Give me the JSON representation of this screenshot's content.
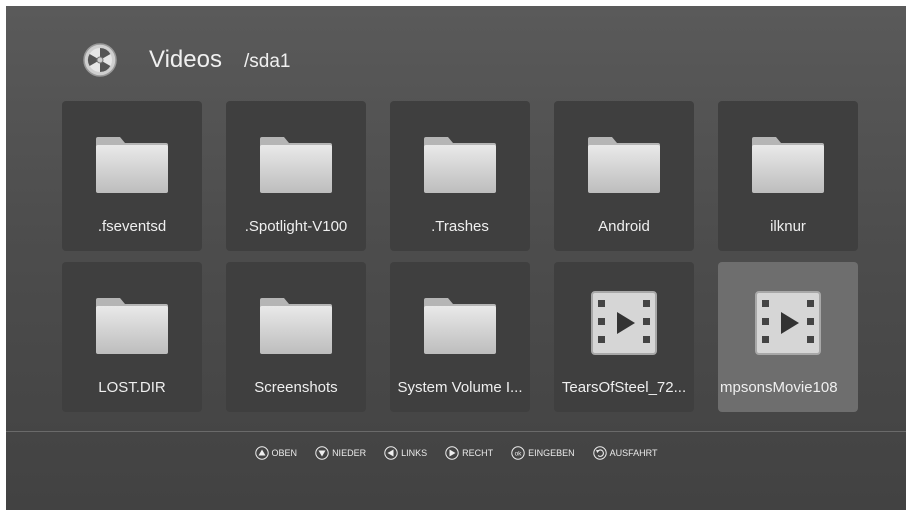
{
  "header": {
    "title": "Videos",
    "path": "/sda1"
  },
  "tiles": [
    {
      "label": ".fseventsd",
      "icon": "folder-icon"
    },
    {
      "label": ".Spotlight-V100",
      "icon": "folder-icon"
    },
    {
      "label": ".Trashes",
      "icon": "folder-icon"
    },
    {
      "label": "Android",
      "icon": "folder-icon"
    },
    {
      "label": "ilknur",
      "icon": "folder-icon"
    },
    {
      "label": "LOST.DIR",
      "icon": "folder-icon"
    },
    {
      "label": "Screenshots",
      "icon": "folder-icon"
    },
    {
      "label": "System Volume I...",
      "icon": "folder-icon"
    },
    {
      "label": "TearsOfSteel_72...",
      "icon": "video-file-icon"
    },
    {
      "label": "mpsonsMovie108",
      "icon": "video-file-icon"
    }
  ],
  "hints": [
    {
      "label": "OBEN",
      "icon": "up-arrow-icon"
    },
    {
      "label": "NIEDER",
      "icon": "down-arrow-icon"
    },
    {
      "label": "LINKS",
      "icon": "left-arrow-icon"
    },
    {
      "label": "RECHT",
      "icon": "right-arrow-icon"
    },
    {
      "label": "EINGEBEN",
      "icon": "ok-icon",
      "glyph": "ok"
    },
    {
      "label": "AUSFAHRT",
      "icon": "back-icon"
    }
  ],
  "colors": {
    "background": "#4d4d4d",
    "tile": "#3f3f3f",
    "selected_tile": "#6e6e6e",
    "text": "#f0f0f0"
  }
}
